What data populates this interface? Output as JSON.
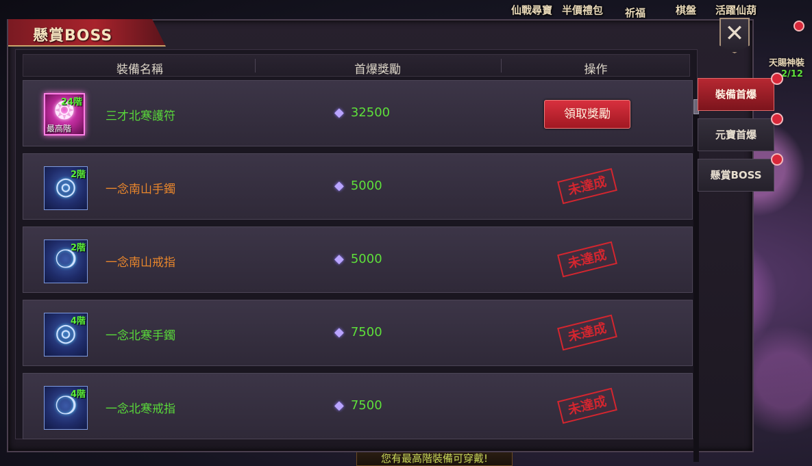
{
  "hud": {
    "top_items": [
      "仙戰尋寶",
      "半價禮包",
      "祈福",
      "棋盤",
      "活躍仙葫"
    ],
    "side_title": "天賜神裝",
    "side_count": "2/12",
    "bottom_notice": "您有最高階裝備可穿戴!"
  },
  "window": {
    "title": "懸賞BOSS",
    "close_icon": "close-icon"
  },
  "table": {
    "headers": [
      "裝備名稱",
      "首爆獎勵",
      "操作"
    ],
    "rows": [
      {
        "tier": "24階",
        "max_tier": "最高階",
        "name": "三才北寒護符",
        "name_color": "#59d93a",
        "reward": "32500",
        "action": "領取獎勵",
        "action_type": "button",
        "icon": "amulet-icon",
        "glyph": "❂",
        "legendary": true
      },
      {
        "tier": "2階",
        "max_tier": "",
        "name": "一念南山手鐲",
        "name_color": "#e8862c",
        "reward": "5000",
        "action": "未達成",
        "action_type": "stamp",
        "icon": "bracelet-icon",
        "glyph": "◎",
        "legendary": false
      },
      {
        "tier": "2階",
        "max_tier": "",
        "name": "一念南山戒指",
        "name_color": "#e8862c",
        "reward": "5000",
        "action": "未達成",
        "action_type": "stamp",
        "icon": "ring-icon",
        "glyph": "❍",
        "legendary": false
      },
      {
        "tier": "4階",
        "max_tier": "",
        "name": "一念北寒手鐲",
        "name_color": "#59d93a",
        "reward": "7500",
        "action": "未達成",
        "action_type": "stamp",
        "icon": "bracelet-icon",
        "glyph": "◎",
        "legendary": false
      },
      {
        "tier": "4階",
        "max_tier": "",
        "name": "一念北寒戒指",
        "name_color": "#59d93a",
        "reward": "7500",
        "action": "未達成",
        "action_type": "stamp",
        "icon": "ring-icon",
        "glyph": "❍",
        "legendary": false
      }
    ]
  },
  "side_tabs": [
    {
      "label": "裝備首爆",
      "active": true
    },
    {
      "label": "元寶首爆",
      "active": false
    },
    {
      "label": "懸賞BOSS",
      "active": false
    }
  ]
}
